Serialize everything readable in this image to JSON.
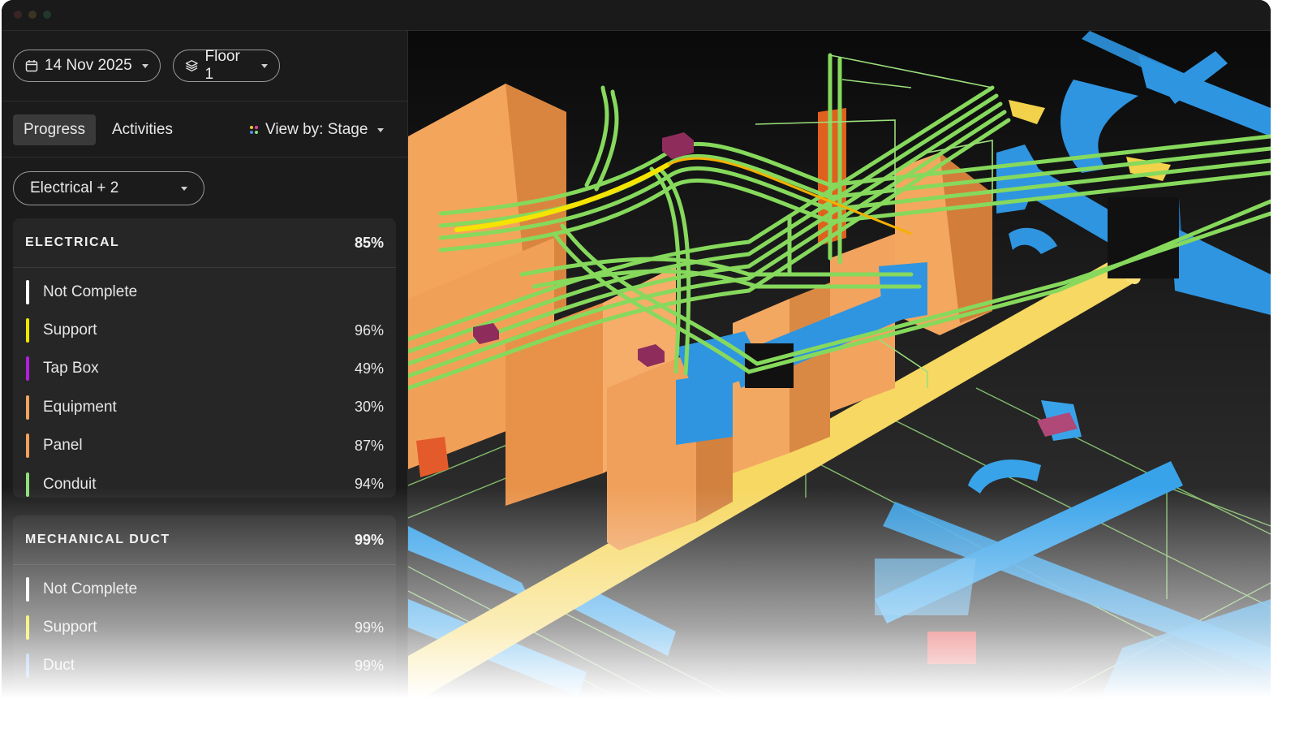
{
  "toolbar": {
    "date_label": "14 Nov 2025",
    "floor_label": "Floor 1"
  },
  "tabs": {
    "progress": "Progress",
    "activities": "Activities",
    "view_by": "View by: Stage"
  },
  "filter": {
    "trade_label": "Electrical + 2"
  },
  "sections": [
    {
      "title": "ELECTRICAL",
      "percent": "85%",
      "items": [
        {
          "label": "Not Complete",
          "value": "",
          "color": "#ffffff"
        },
        {
          "label": "Support",
          "value": "96%",
          "color": "#f2e600"
        },
        {
          "label": "Tap Box",
          "value": "49%",
          "color": "#b11fe0"
        },
        {
          "label": "Equipment",
          "value": "30%",
          "color": "#f3a45f"
        },
        {
          "label": "Panel",
          "value": "87%",
          "color": "#f2a15c"
        },
        {
          "label": "Conduit",
          "value": "94%",
          "color": "#8fe07a"
        }
      ]
    },
    {
      "title": "MECHANICAL DUCT",
      "percent": "99%",
      "items": [
        {
          "label": "Not Complete",
          "value": "",
          "color": "#ffffff"
        },
        {
          "label": "Support",
          "value": "99%",
          "color": "#f2e600"
        },
        {
          "label": "Duct",
          "value": "99%",
          "color": "#4f8cf0"
        }
      ]
    }
  ],
  "colors": {
    "duct": "#2e9ae6",
    "conduit": "#86d95c",
    "equipment": "#f2a35b",
    "support_pipe": "#f6d862",
    "tap_box": "#8e2d5c"
  }
}
